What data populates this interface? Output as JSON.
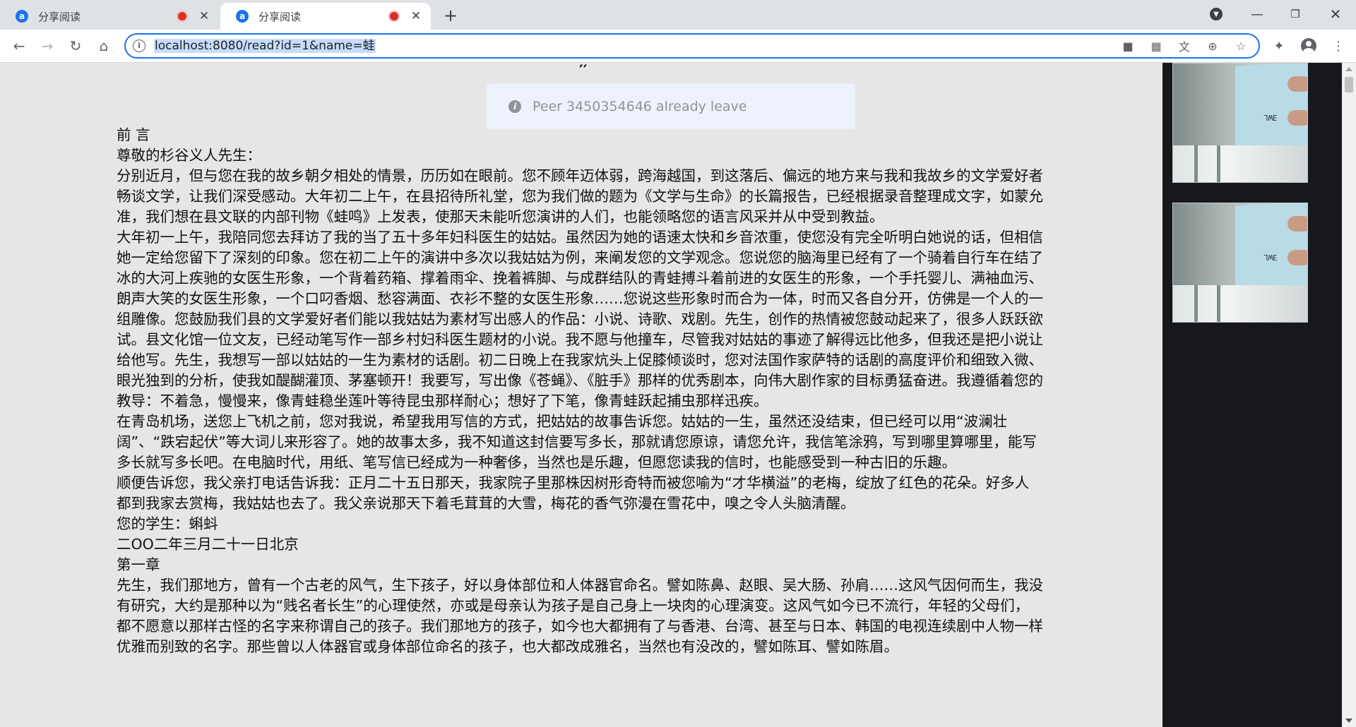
{
  "tabs": [
    {
      "title": "分享阅读",
      "favicon": "a",
      "active": false
    },
    {
      "title": "分享阅读",
      "favicon": "a",
      "active": true
    }
  ],
  "toolbar": {
    "url": "localhost:8080/read?id=1&name=蛙"
  },
  "toast": {
    "message": "Peer 3450354646 already leave",
    "icon": "info-icon"
  },
  "article": {
    "title_partial": "′′",
    "paragraphs": [
      "前 言",
      "尊敬的杉谷义人先生：",
      "分别近月，但与您在我的故乡朝夕相处的情景，历历如在眼前。您不顾年迈体弱，跨海越国，到这落后、偏远的地方来与我和我故乡的文学爱好者畅谈文学，让我们深受感动。大年初二上午，在县招待所礼堂，您为我们做的题为《文学与生命》的长篇报告，已经根据录音整理成文字，如蒙允准，我们想在县文联的内部刊物《蛙鸣》上发表，使那天未能听您演讲的人们，也能领略您的语言风采并从中受到教益。",
      "大年初一上午，我陪同您去拜访了我的当了五十多年妇科医生的姑姑。虽然因为她的语速太快和乡音浓重，使您没有完全听明白她说的话，但相信她一定给您留下了深刻的印象。您在初二上午的演讲中多次以我姑姑为例，来阐发您的文学观念。您说您的脑海里已经有了一个骑着自行车在结了冰的大河上疾驰的女医生形象，一个背着药箱、撑着雨伞、挽着裤脚、与成群结队的青蛙搏斗着前进的女医生的形象，一个手托婴儿、满袖血污、朗声大笑的女医生形象，一个口叼香烟、愁容满面、衣衫不整的女医生形象……您说这些形象时而合为一体，时而又各自分开，仿佛是一个人的一组雕像。您鼓励我们县的文学爱好者们能以我姑姑为素材写出感人的作品：小说、诗歌、戏剧。先生，创作的热情被您鼓动起来了，很多人跃跃欲试。县文化馆一位文友，已经动笔写作一部乡村妇科医生题材的小说。我不愿与他撞车，尽管我对姑姑的事迹了解得远比他多，但我还是把小说让给他写。先生，我想写一部以姑姑的一生为素材的话剧。初二日晚上在我家炕头上促膝倾谈时，您对法国作家萨特的话剧的高度评价和细致入微、眼光独到的分析，使我如醍醐灌顶、茅塞顿开！我要写，写出像《苍蝇》、《脏手》那样的优秀剧本，向伟大剧作家的目标勇猛奋进。我遵循着您的教导：不着急，慢慢来，像青蛙稳坐莲叶等待昆虫那样耐心；想好了下笔，像青蛙跃起捕虫那样迅疾。",
      "在青岛机场，送您上飞机之前，您对我说，希望我用写信的方式，把姑姑的故事告诉您。姑姑的一生，虽然还没结束，但已经可以用“波澜壮阔”、“跌宕起伏”等大词儿来形容了。她的故事太多，我不知道这封信要写多长，那就请您原谅，请您允许，我信笔涂鸦，写到哪里算哪里，能写多长就写多长吧。在电脑时代，用纸、笔写信已经成为一种奢侈，当然也是乐趣，但愿您读我的信时，也能感受到一种古旧的乐趣。",
      "顺便告诉您，我父亲打电话告诉我：正月二十五日那天，我家院子里那株因树形奇特而被您喻为“才华横溢”的老梅，绽放了红色的花朵。好多人都到我家去赏梅，我姑姑也去了。我父亲说那天下着毛茸茸的大雪，梅花的香气弥漫在雪花中，嗅之令人头脑清醒。",
      "您的学生：蝌蚪",
      "二OO二年三月二十一日北京",
      "第一章",
      "先生，我们那地方，曾有一个古老的风气，生下孩子，好以身体部位和人体器官命名。譬如陈鼻、赵眼、吴大肠、孙肩……这风气因何而生，我没有研究，大约是那种以为“贱名者长生”的心理使然，亦或是母亲认为孩子是自己身上一块肉的心理演变。这风气如今已不流行，年轻的父母们，都不愿意以那样古怪的名字来称谓自己的孩子。我们那地方的孩子，如今也大都拥有了与香港、台湾、甚至与日本、韩国的电视连续剧中人物一样优雅而别致的名字。那些曾以人体器官或身体部位命名的孩子，也大都改成雅名，当然也有没改的，譬如陈耳、譬如陈眉。"
    ]
  },
  "sidebar": {
    "videos": [
      {
        "label": "remote-video-1",
        "paper_text": "ƎWL"
      },
      {
        "label": "remote-video-2",
        "paper_text": "ƎWL"
      }
    ]
  },
  "colors": {
    "accent": "#1a73e8",
    "tab_bar": "#dee1e6",
    "page_bg": "#e6e6e6",
    "sidebar_bg": "#16181d",
    "toast_bg": "#edf2fc",
    "toast_text": "#909399"
  }
}
